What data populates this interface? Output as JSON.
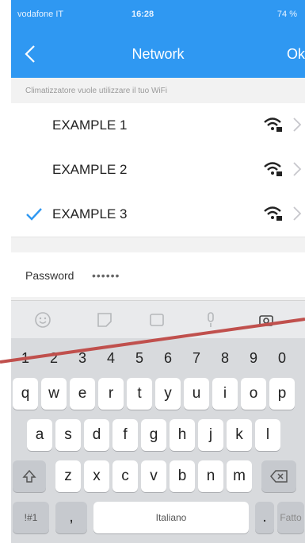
{
  "status": {
    "carrier": "vodafone IT",
    "time": "16:28",
    "battery": "74 %"
  },
  "nav": {
    "title": "Network",
    "ok_label": "Ok"
  },
  "hint": "Climatizzatore vuole utilizzare il tuo WiFi",
  "networks": [
    {
      "name": "EXAMPLE 1",
      "selected": false
    },
    {
      "name": "EXAMPLE 2",
      "selected": false
    },
    {
      "name": "EXAMPLE 3",
      "selected": true
    }
  ],
  "password": {
    "label": "Password",
    "value": "••••••"
  },
  "keyboard": {
    "numbers": [
      "1",
      "2",
      "3",
      "4",
      "5",
      "6",
      "7",
      "8",
      "9",
      "0"
    ],
    "row1": [
      "q",
      "w",
      "e",
      "r",
      "t",
      "y",
      "u",
      "i",
      "o",
      "p"
    ],
    "row2": [
      "a",
      "s",
      "d",
      "f",
      "g",
      "h",
      "j",
      "k",
      "l"
    ],
    "row3": [
      "z",
      "x",
      "c",
      "v",
      "b",
      "n",
      "m"
    ],
    "symbols": "!#1",
    "comma": ",",
    "space": "Italiano",
    "period": ".",
    "done": "Fatto"
  },
  "colors": {
    "accent": "#2f98f2",
    "check": "#2f98f2",
    "annotation": "#c0504d"
  }
}
